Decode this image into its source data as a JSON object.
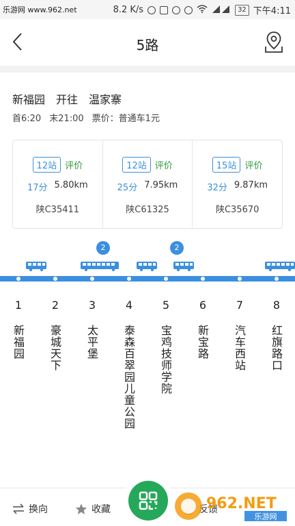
{
  "status_bar": {
    "carrier": "乐游网 www.962.net",
    "speed": "8.2 K/s",
    "battery": "32",
    "time": "下午4:11"
  },
  "header": {
    "title": "5路"
  },
  "route": {
    "from": "新福园",
    "direction": "开往",
    "to": "温家寨",
    "first": "首6:20",
    "last": "末21:00",
    "fare": "票价：普通车1元"
  },
  "buses": [
    {
      "stops": "12站",
      "rate": "评价",
      "mins": "17分",
      "dist": "5.80km",
      "plate": "陕C35411"
    },
    {
      "stops": "12站",
      "rate": "评价",
      "mins": "25分",
      "dist": "7.95km",
      "plate": "陕C61325"
    },
    {
      "stops": "15站",
      "rate": "评价",
      "mins": "32分",
      "dist": "9.87km",
      "plate": "陕C35670"
    }
  ],
  "line": {
    "counts": [
      "2",
      "2"
    ]
  },
  "stops": [
    {
      "num": "1",
      "name": "新福园"
    },
    {
      "num": "2",
      "name": "豪城天下"
    },
    {
      "num": "3",
      "name": "太平堡"
    },
    {
      "num": "4",
      "name": "泰森百翠园儿童公园"
    },
    {
      "num": "5",
      "name": "宝鸡技师学院"
    },
    {
      "num": "6",
      "name": "新宝路"
    },
    {
      "num": "7",
      "name": "汽车西站"
    },
    {
      "num": "8",
      "name": "红旗路口"
    }
  ],
  "bottom": {
    "switch": "换向",
    "favorite": "收藏",
    "feedback": "反馈"
  },
  "watermark": {
    "text": "962.NET",
    "sub": "乐游网"
  },
  "colors": {
    "accent": "#3b8fe0",
    "green": "#26a85a",
    "rate": "#2c9a3a"
  }
}
